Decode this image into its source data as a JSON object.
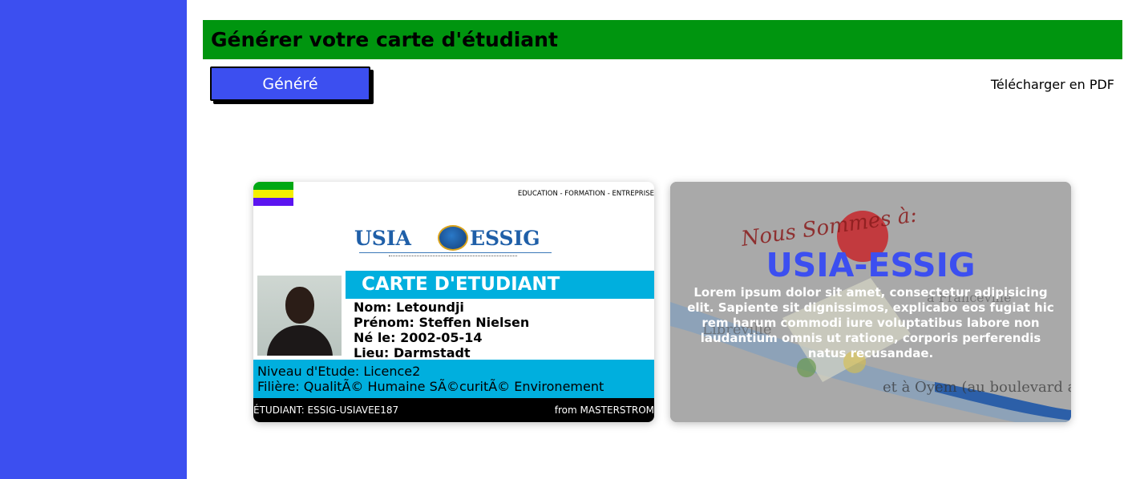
{
  "header": {
    "title": "Générer votre carte d'étudiant"
  },
  "toolbar": {
    "generate_label": "Généré",
    "download_label": "Télécharger en PDF"
  },
  "card_front": {
    "flag_colors": [
      "#00a814",
      "#f4ef00",
      "#5b14f0"
    ],
    "tagline": "EDUCATION - FORMATION - ENTREPRISE",
    "logo": {
      "left_text": "USIA",
      "right_text": "ESSIG"
    },
    "title": "CARTE D'ETUDIANT",
    "nom": "Nom: Letoundji",
    "prenom": "Prénom: Steffen Nielsen",
    "naissance": "Né le: 2002-05-14",
    "lieu": "Lieu: Darmstadt",
    "niveau": "Niveau d'Etude: Licence2",
    "filiere": "Filière: QualitÃ© Humaine SÃ©curitÃ© Environement",
    "student_id": "ÉTUDIANT: ESSIG-USIAVEE187",
    "footer_right": "from MASTERSTROM"
  },
  "card_back": {
    "title": "USIA-ESSIG",
    "text": "Lorem ipsum dolor sit amet, consectetur adipisicing elit. Sapiente sit dignissimos, explicabo eos fugiat hic rem harum commodi iure voluptatibus labore non laudantium omnis ut ratione, corporis perferendis natus recusandae."
  },
  "colors": {
    "sidebar": "#3c4ff0",
    "header": "#00950f",
    "card_band": "#00afde",
    "back_title": "#3c4ff0"
  }
}
